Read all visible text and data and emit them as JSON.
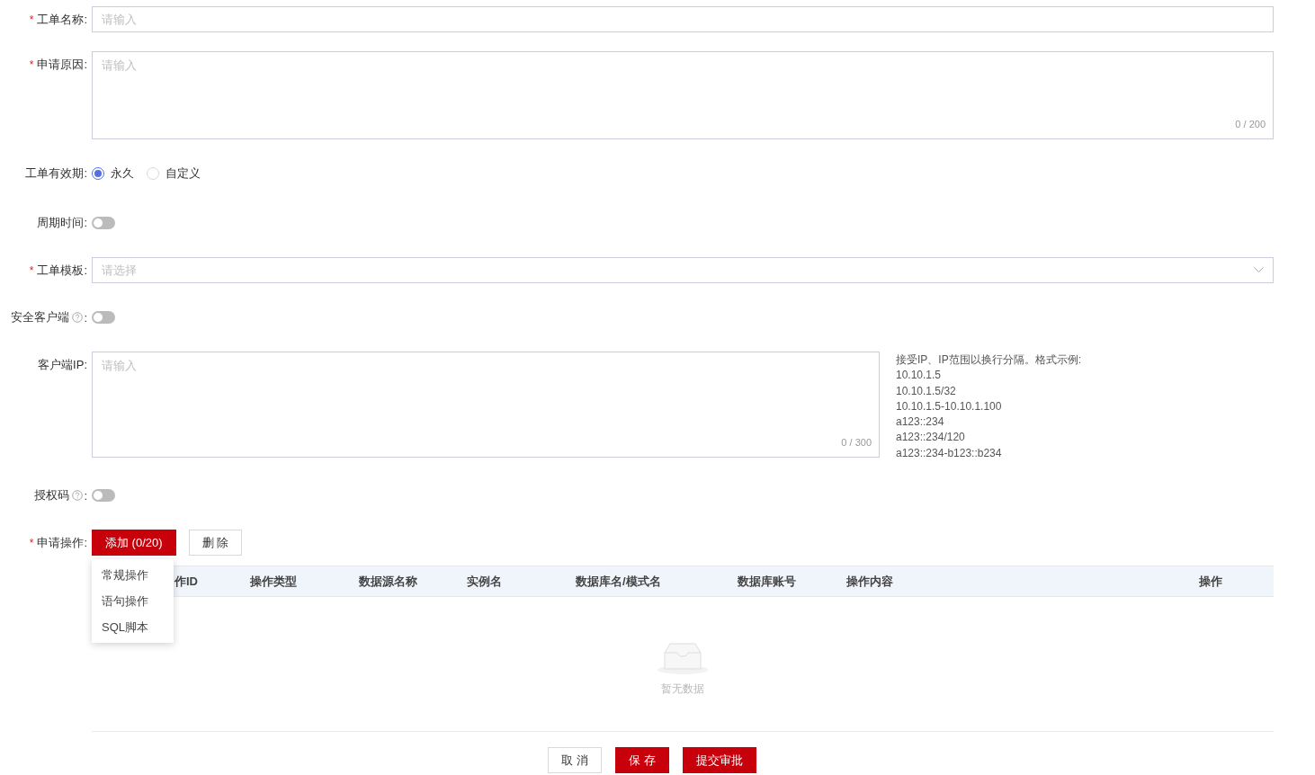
{
  "form": {
    "fields": [
      {
        "kind": "input",
        "required_mark": "*",
        "label": "工单名称:",
        "placeholder": "请输入"
      },
      {
        "kind": "textarea",
        "required_mark": "*",
        "label": "申请原因:",
        "placeholder": "请输入",
        "counter": "0 / 200"
      },
      {
        "kind": "radio",
        "label": "工单有效期:",
        "options": [
          {
            "label": "永久",
            "selected": true
          },
          {
            "label": "自定义",
            "selected": false
          }
        ]
      },
      {
        "kind": "switch",
        "label": "周期时间:",
        "on": false
      },
      {
        "kind": "select",
        "required_mark": "*",
        "label": "工单模板:",
        "placeholder": "请选择"
      },
      {
        "kind": "switch",
        "label": "安全客户端",
        "label_suffix": ":",
        "help": true,
        "on": false
      },
      {
        "kind": "textarea_hint",
        "label": "客户端IP:",
        "placeholder": "请输入",
        "counter": "0 / 300",
        "hint": [
          "接受IP、IP范围以换行分隔。格式示例:",
          "10.10.1.5",
          "10.10.1.5/32",
          "10.10.1.5-10.10.1.100",
          "a123::234",
          "a123::234/120",
          "a123::234-b123::b234"
        ]
      },
      {
        "kind": "switch",
        "label": "授权码",
        "label_suffix": ":",
        "help": true,
        "on": false
      },
      {
        "kind": "ops",
        "required_mark": "*",
        "label": "申请操作:",
        "add_button": "添加 (0/20)",
        "delete_button": "删 除",
        "menu": [
          "常规操作",
          "语句操作",
          "SQL脚本"
        ]
      }
    ]
  },
  "table": {
    "columns": [
      "作ID",
      "操作类型",
      "数据源名称",
      "实例名",
      "数据库名/模式名",
      "数据库账号",
      "操作内容",
      "操作"
    ],
    "empty_text": "暂无数据"
  },
  "footer": {
    "buttons": [
      {
        "label": "取 消",
        "kind": "default"
      },
      {
        "label": "保 存",
        "kind": "primary"
      },
      {
        "label": "提交审批",
        "kind": "primary"
      }
    ]
  }
}
